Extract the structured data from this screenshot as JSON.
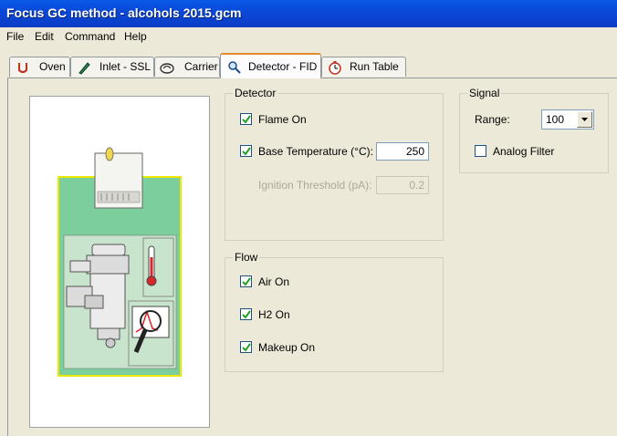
{
  "window": {
    "title": "Focus GC method - alcohols 2015.gcm"
  },
  "menu": {
    "items": [
      "File",
      "Edit",
      "Command",
      "Help"
    ]
  },
  "tabs": [
    {
      "label": "Oven",
      "icon": "oven-icon"
    },
    {
      "label": "Inlet - SSL",
      "icon": "inlet-pen-icon"
    },
    {
      "label": "Carrier",
      "icon": "carrier-gauge-icon"
    },
    {
      "label": "Detector - FID",
      "icon": "magnifier-icon",
      "active": true
    },
    {
      "label": "Run Table",
      "icon": "stopwatch-icon"
    }
  ],
  "detector": {
    "legend": "Detector",
    "flame_on": {
      "label": "Flame On",
      "checked": true
    },
    "base_temp": {
      "label": "Base Temperature (°C):",
      "checked": true,
      "value": "250"
    },
    "ignition": {
      "label": "Ignition Threshold (pA):",
      "value": "0.2",
      "disabled": true
    }
  },
  "flow": {
    "legend": "Flow",
    "air_on": {
      "label": "Air On",
      "checked": true
    },
    "h2_on": {
      "label": "H2 On",
      "checked": true
    },
    "makeup_on": {
      "label": "Makeup On",
      "checked": true
    }
  },
  "signal": {
    "legend": "Signal",
    "range_label": "Range:",
    "range_value": "100",
    "analog_filter": {
      "label": "Analog Filter",
      "checked": false
    }
  },
  "colors": {
    "titlebar": "#0a4fd8",
    "tab_highlight": "#e68b2c",
    "panel": "#ece9d8",
    "diagram_green": "#7ccf9c"
  }
}
